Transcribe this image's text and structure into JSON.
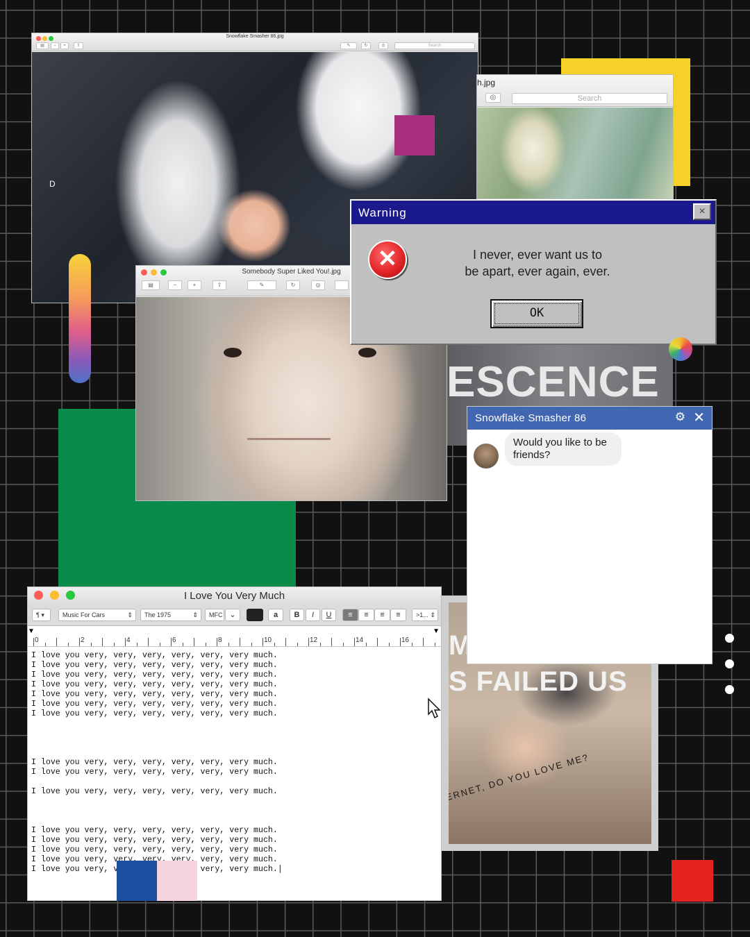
{
  "preview_window_1": {
    "title": "Snowflake Smasher 86.jpg",
    "search_placeholder": "Search",
    "overlay_letter": "D"
  },
  "preview_window_2": {
    "title_fragment": "h.jpg",
    "search_placeholder": "Search"
  },
  "preview_window_3": {
    "title": "Somebody Super Liked You!.jpg"
  },
  "poster": {
    "top_text": "ESCENCE",
    "mid_text": "MO",
    "failed_text": "S FAILED US",
    "curved_text": "INTERNET, DO YOU LOVE ME?"
  },
  "warning_dialog": {
    "title": "Warning",
    "close_label": "×",
    "message_line_1": "I never, ever want us to",
    "message_line_2": "be apart, ever again, ever.",
    "ok_label": "OK"
  },
  "chat": {
    "contact_name": "Snowflake Smasher 86",
    "message": "Would you like to be friends?"
  },
  "editor": {
    "title": "I Love You Very Much",
    "toolbar": {
      "paragraph": "¶",
      "style": "Music For Cars",
      "font": "The 1975",
      "size": "MFC",
      "text_color_label": "a",
      "bold": "B",
      "italic": "I",
      "underline": "U",
      "spacing": ">1..."
    },
    "ruler_numbers": [
      "0",
      "2",
      "4",
      "6",
      "8",
      "10",
      "12",
      "14",
      "16"
    ],
    "lines": [
      "I love you very, very, very, very, very, very much.",
      "I love you very, very, very, very, very, very much.",
      "I love you very, very, very, very, very, very much.",
      "I love you very, very, very, very, very, very much.",
      "I love you very, very, very, very, very, very much.",
      "I love you very, very, very, very, very, very much.",
      "I love you very, very, very, very, very, very much.",
      "",
      "",
      "",
      "",
      "I love you very, very, very, very, very, very much.",
      "I love you very, very, very, very, very, very much.",
      "",
      "I love you very, very, very, very, very, very much.",
      "",
      "",
      "",
      "I love you very, very, very, very, very, very much.",
      "I love you very, very, very, very, very, very much.",
      "I love you very, very, very, very, very, very much.",
      "I love you very, very, very, very, very, very much.",
      "I love you very, very, very, very, very, very much.|"
    ]
  },
  "colors": {
    "warning_titlebar": "#1a1a8c",
    "chat_header": "#4267b2",
    "yellow_square": "#f6d12a",
    "green_block": "#0a8a4b",
    "red_square": "#e4221f",
    "magenta_square": "#a8307e",
    "blue_square": "#1d4fa0",
    "pink_square": "#f5d3df"
  }
}
